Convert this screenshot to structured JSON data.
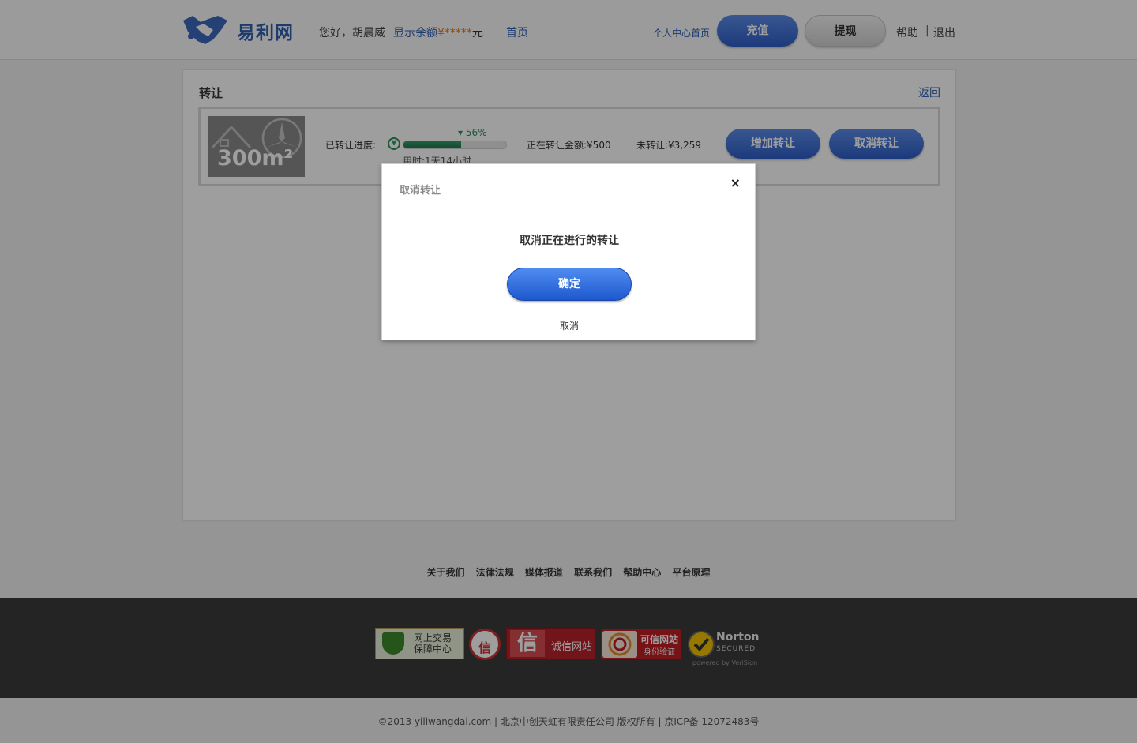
{
  "header": {
    "logo_text": "易利网",
    "greeting": "您好，胡晨威",
    "balance_label": "显示余额",
    "balance_masked": "¥*****",
    "balance_unit": "元",
    "home": "首页",
    "user_center": "个人中心首页",
    "recharge": "充值",
    "withdraw": "提现",
    "help": "帮助",
    "separator": "|",
    "logout": "退出"
  },
  "panel": {
    "title": "转让",
    "back": "返回",
    "item": {
      "area_label": "300m²",
      "progress_label": "已转让进度:",
      "progress_percent": 56,
      "progress_text": "56%",
      "time_used": "用时:1天14小时",
      "amount_label": "正在转让金额:¥500",
      "remaining_label": "未转让:¥3,259",
      "add_button": "增加转让",
      "cancel_button": "取消转让"
    }
  },
  "modal": {
    "title": "取消转让",
    "close": "×",
    "message": "取消正在进行的转让",
    "confirm": "确定",
    "cancel": "取消"
  },
  "footer": {
    "links": [
      "关于我们",
      "法律法规",
      "媒体报道",
      "联系我们",
      "帮助中心",
      "平台原理"
    ],
    "badges": {
      "b1_line1": "网上交易",
      "b1_line2": "保障中心",
      "b2": "信",
      "b3_big": "信",
      "b3_text": "诚信网站",
      "b4_line1": "可信网站",
      "b4_line2": "身份验证",
      "b5_name": "Norton",
      "b5_sub": "SECURED",
      "b5_powered": "powered by VeriSign"
    },
    "copyright": "©2013 yiliwangdai.com | 北京中创天虹有限责任公司 版权所有 | 京ICP备 12072483号"
  },
  "colors": {
    "brand_blue": "#2f5fb0",
    "button_blue": "#2e5fc8",
    "progress_green": "#2e8f5e",
    "balance_orange": "#e07a1a"
  }
}
